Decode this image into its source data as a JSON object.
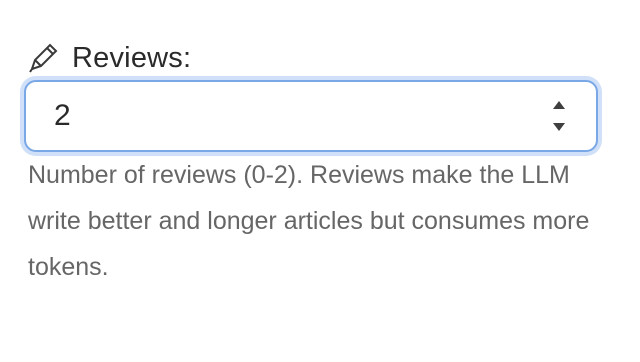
{
  "field": {
    "label": "Reviews:",
    "value": "2",
    "help": "Number of reviews (0-2). Reviews make the LLM write better and longer articles but consumes more tokens.",
    "min": 0,
    "max": 2
  },
  "icons": {
    "label_icon": "pencil-icon",
    "increment": "triangle-up-icon",
    "decrement": "triangle-down-icon"
  },
  "colors": {
    "focus_border": "#7aa7e6",
    "focus_ring": "#cfe0f8",
    "label": "#2a2a2a",
    "help": "#666666"
  }
}
